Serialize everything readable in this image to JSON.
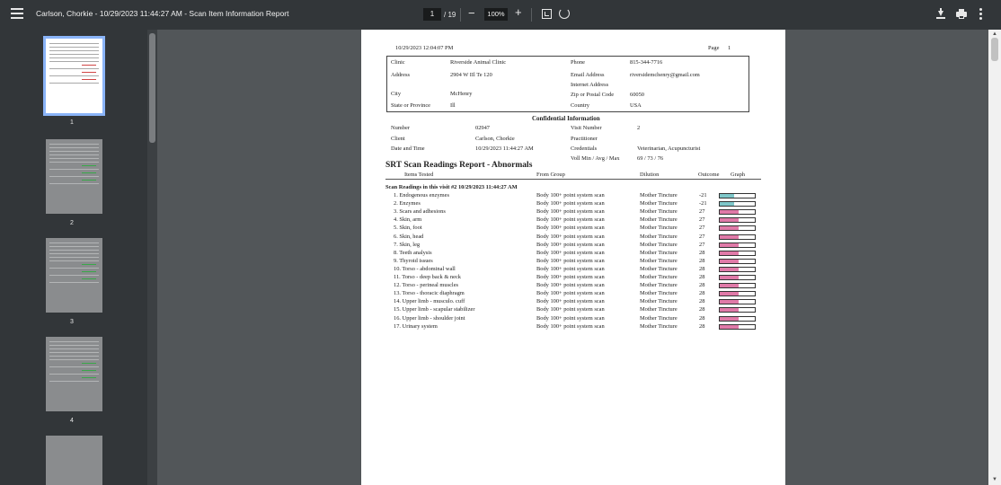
{
  "toolbar": {
    "title": "Carlson, Chorkie - 10/29/2023 11:44:27 AM - Scan Item Information Report",
    "page_current": "1",
    "page_total": "/ 19",
    "zoom": "100%",
    "zoom_out_label": "−",
    "zoom_in_label": "+"
  },
  "thumbnails": [
    {
      "label": "1"
    },
    {
      "label": "2"
    },
    {
      "label": "3"
    },
    {
      "label": "4"
    }
  ],
  "report": {
    "timestamp": "10/29/2023 12:04:07 PM",
    "page_label": "Page",
    "page_number": "1",
    "clinic": {
      "clinic_label": "Clinic",
      "clinic_value": "Riverside Animal Clinic",
      "address_label": "Address",
      "address_value": "2904 W IIl Te 120",
      "city_label": "City",
      "city_value": "McHenry",
      "state_label": "State or Province",
      "state_value": "Ill",
      "phone_label": "Phone",
      "phone_value": "815-344-7716",
      "email_label": "Email Address",
      "email_value": "riversidemchenry@gmail.com",
      "internet_label": "Internet Address",
      "zip_label": "Zip or Postal Code",
      "zip_value": "60050",
      "country_label": "Country",
      "country_value": "USA"
    },
    "confidential_title": "Confidential Information",
    "confidential": {
      "number_label": "Number",
      "number_value": "02947",
      "client_label": "Client",
      "client_value": "Carlson, Chorkie",
      "date_label": "Date and Time",
      "date_value": "10/29/2023 11:44:27 AM",
      "visit_label": "Visit Number",
      "visit_value": "2",
      "practitioner_label": "Practitioner",
      "credentials_label": "Credentials",
      "credentials_value": "Veterinarian, Acupuncturist",
      "voll_label": "Voll Min / Avg / Max",
      "voll_value": "69 / 73 / 76"
    },
    "section_title": "SRT Scan Readings Report - Abnormals",
    "columns": {
      "items": "Items Tested",
      "from": "From Group",
      "dilution": "Dilution",
      "outcome": "Outcome",
      "graph": "Graph"
    },
    "visit_heading": "Scan Readings in this visit #2 10/29/2023 11:44:27 AM",
    "rows": [
      {
        "item": "1.  Endogenous enzymes",
        "group": "Body 100+ point system scan",
        "dilution": "Mother Tincture",
        "outcome": "-21",
        "level": 0.42,
        "color": "#7ec7c9"
      },
      {
        "item": "2.  Enzymes",
        "group": "Body 100+ point system scan",
        "dilution": "Mother Tincture",
        "outcome": "-21",
        "level": 0.42,
        "color": "#7ec7c9"
      },
      {
        "item": "3.  Scars and adhesions",
        "group": "Body 100+ point system scan",
        "dilution": "Mother Tincture",
        "outcome": "27",
        "level": 0.55,
        "color": "#e07aa8"
      },
      {
        "item": "4.  Skin, arm",
        "group": "Body 100+ point system scan",
        "dilution": "Mother Tincture",
        "outcome": "27",
        "level": 0.55,
        "color": "#e07aa8"
      },
      {
        "item": "5.  Skin, foot",
        "group": "Body 100+ point system scan",
        "dilution": "Mother Tincture",
        "outcome": "27",
        "level": 0.55,
        "color": "#e07aa8"
      },
      {
        "item": "6.  Skin, head",
        "group": "Body 100+ point system scan",
        "dilution": "Mother Tincture",
        "outcome": "27",
        "level": 0.55,
        "color": "#e07aa8"
      },
      {
        "item": "7.  Skin, leg",
        "group": "Body 100+ point system scan",
        "dilution": "Mother Tincture",
        "outcome": "27",
        "level": 0.55,
        "color": "#e07aa8"
      },
      {
        "item": "8.  Teeth analysis",
        "group": "Body 100+ point system scan",
        "dilution": "Mother Tincture",
        "outcome": "28",
        "level": 0.55,
        "color": "#e07aa8"
      },
      {
        "item": "9.  Thyroid issues",
        "group": "Body 100+ point system scan",
        "dilution": "Mother Tincture",
        "outcome": "28",
        "level": 0.55,
        "color": "#e07aa8"
      },
      {
        "item": "10.  Torso - abdominal wall",
        "group": "Body 100+ point system scan",
        "dilution": "Mother Tincture",
        "outcome": "28",
        "level": 0.55,
        "color": "#e07aa8"
      },
      {
        "item": "11.  Torso - deep back & neck",
        "group": "Body 100+ point system scan",
        "dilution": "Mother Tincture",
        "outcome": "28",
        "level": 0.55,
        "color": "#e07aa8"
      },
      {
        "item": "12.  Torso - perineal muscles",
        "group": "Body 100+ point system scan",
        "dilution": "Mother Tincture",
        "outcome": "28",
        "level": 0.55,
        "color": "#e07aa8"
      },
      {
        "item": "13.  Torso - thoracic diaphragm",
        "group": "Body 100+ point system scan",
        "dilution": "Mother Tincture",
        "outcome": "28",
        "level": 0.55,
        "color": "#e07aa8"
      },
      {
        "item": "14.  Upper limb - musculo. cuff",
        "group": "Body 100+ point system scan",
        "dilution": "Mother Tincture",
        "outcome": "28",
        "level": 0.55,
        "color": "#e07aa8"
      },
      {
        "item": "15.  Upper limb - scapular stabilizer",
        "group": "Body 100+ point system scan",
        "dilution": "Mother Tincture",
        "outcome": "28",
        "level": 0.55,
        "color": "#e07aa8"
      },
      {
        "item": "16.  Upper limb - shoulder joint",
        "group": "Body 100+ point system scan",
        "dilution": "Mother Tincture",
        "outcome": "28",
        "level": 0.55,
        "color": "#e07aa8"
      },
      {
        "item": "17.  Urinary system",
        "group": "Body 100+ point system scan",
        "dilution": "Mother Tincture",
        "outcome": "28",
        "level": 0.55,
        "color": "#e07aa8"
      }
    ]
  }
}
